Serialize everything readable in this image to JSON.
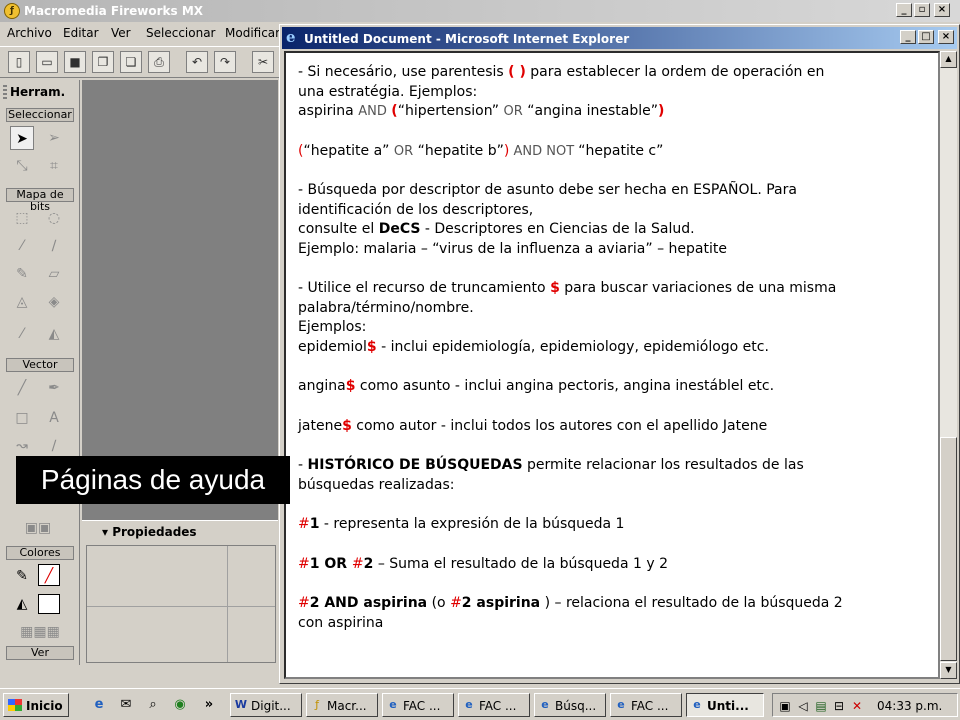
{
  "fireworks": {
    "title": "Macromedia Fireworks MX",
    "menu": [
      "Archivo",
      "Editar",
      "Ver",
      "Seleccionar",
      "Modificar"
    ],
    "tools_panel": {
      "title": "Herram.",
      "sections": [
        "Seleccionar",
        "Mapa de bits",
        "Vector",
        "Colores",
        "Ver"
      ]
    },
    "properties_title": "Propiedades"
  },
  "ie": {
    "title": "Untitled Document - Microsoft Internet Explorer",
    "content": {
      "p1_l1a": "- Si necesário, use parentesis ",
      "p1_paren": "( )",
      "p1_l1b": " para establecer la ordem de operación en",
      "p1_l2": "una estratégia. Ejemplos:",
      "p1_l3a": "aspirina ",
      "p1_and": "AND",
      "p1_l3b": "(",
      "p1_l3c": "“hipertension” ",
      "p1_or": "OR",
      "p1_l3d": " “angina inestable”",
      "p1_l3e": ")",
      "p2a": "(",
      "p2b": "“hepatite a” ",
      "p2_or1": "OR",
      "p2c": " “hepatite b”",
      "p2d": ")",
      "p2_andnot": " AND NOT ",
      "p2e": "“hepatite c”",
      "p3_l1": "- Búsqueda por descriptor de asunto debe ser hecha en ESPAÑOL. Para",
      "p3_l2": "identificación de los descriptores,",
      "p3_l3a": "consulte el ",
      "p3_decs": "DeCS",
      "p3_l3b": " - Descriptores en Ciencias de la Salud.",
      "p3_l4": "Ejemplo: malaria – “virus de la influenza a aviaria” – hepatite",
      "p4_l1a": "- Utilice el recurso de truncamiento ",
      "p4_dollar": "$",
      "p4_l1b": " para buscar variaciones de una misma",
      "p4_l2": "palabra/término/nombre.",
      "p4_l3": "Ejemplos:",
      "p4_l4a": "epidemiol",
      "p4_l4b": " - inclui epidemiología, epidemiology, epidemiólogo etc.",
      "p5a": "angina",
      "p5b": " como asunto - inclui angina pectoris, angina inestáblel etc.",
      "p6a": "jatene",
      "p6b": " como autor - inclui todos los autores con el apellido Jatene",
      "p7a": "- ",
      "p7_hist": "HISTÓRICO DE BÚSQUEDAS",
      "p7b": " permite relacionar los resultados de las",
      "p7_l2": "búsquedas realizadas:",
      "p8_hash": "#",
      "p8_one": "1",
      "p8b": " - representa la expresión de la búsqueda 1",
      "p9_hash1": "#",
      "p9_one": "1 OR ",
      "p9_hash2": "#",
      "p9_two": "2",
      "p9b": " – Suma el resultado de la búsqueda 1 y 2",
      "p10_hash1": "#",
      "p10_a": "2 AND aspirina",
      "p10_b": " (o ",
      "p10_hash2": "#",
      "p10_c": "2 aspirina",
      "p10_d": " ) – relaciona el resultado de la búsqueda 2",
      "p10_l2": "con aspirina"
    }
  },
  "overlay_label": "Páginas de ayuda",
  "taskbar": {
    "start": "Inicio",
    "chevron": "»",
    "tasks": [
      "Digit...",
      "Macr...",
      "FAC ...",
      "FAC ...",
      "Búsq...",
      "FAC ...",
      "Unti..."
    ],
    "clock": "04:33 p.m."
  }
}
